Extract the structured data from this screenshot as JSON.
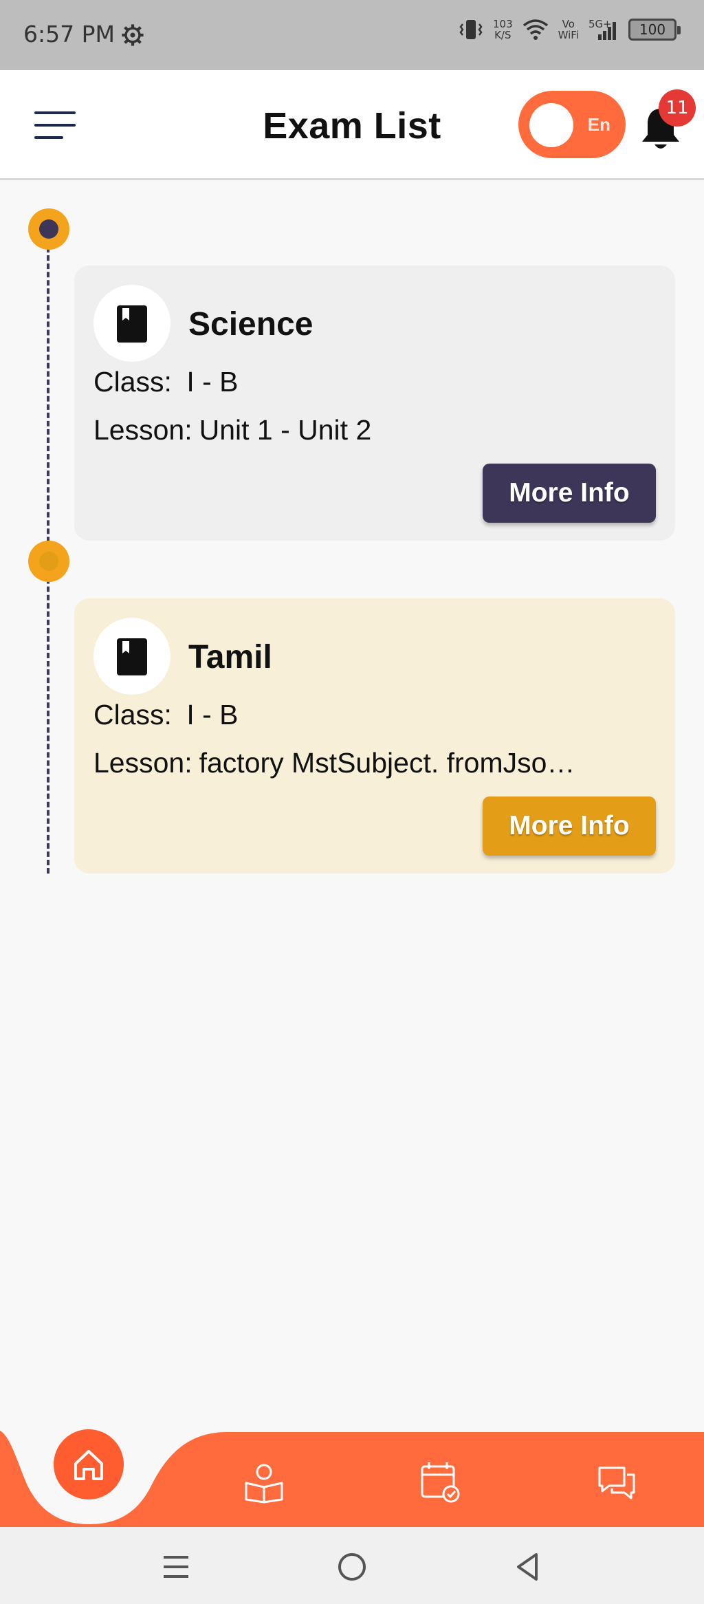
{
  "status_bar": {
    "time": "6:57 PM",
    "net_speed_value": "103",
    "net_speed_unit": "K/S",
    "vowifi_top": "Vo",
    "vowifi_bottom": "WiFi",
    "network": "5G+",
    "battery": "100"
  },
  "app_bar": {
    "title": "Exam List",
    "language": "En",
    "notification_count": "11"
  },
  "exams": [
    {
      "subject": "Science",
      "class_label": "Class:",
      "class_value": "I - B",
      "lesson_label": "Lesson:",
      "lesson_value": "Unit 1 - Unit 2",
      "button_label": "More Info",
      "card_color": "#efefef",
      "button_color": "#3d3658",
      "dot_inner_color": "#3d3658"
    },
    {
      "subject": "Tamil",
      "class_label": "Class:",
      "class_value": "I - B",
      "lesson_label": "Lesson:",
      "lesson_value": "factory MstSubject.  fromJso…",
      "button_label": "More Info",
      "card_color": "#f8efd9",
      "button_color": "#e39d17",
      "dot_inner_color": "#e39d17"
    }
  ],
  "bottom_nav": {
    "items": [
      "home-icon",
      "student-reading-icon",
      "calendar-check-icon",
      "chat-icon"
    ],
    "accent_color": "#ff6b3d"
  },
  "system_nav": {
    "items": [
      "recent-apps-icon",
      "home-circle-icon",
      "back-icon"
    ]
  }
}
